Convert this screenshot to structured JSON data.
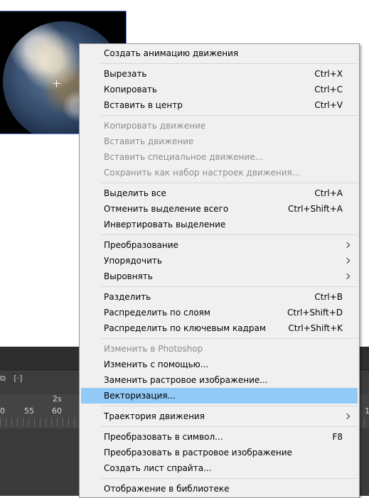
{
  "timeline": {
    "time_marker": "2s",
    "ruler_labels": [
      "0",
      "55",
      "60",
      "1"
    ]
  },
  "menu": {
    "items": [
      {
        "label": "Создать анимацию движения",
        "shortcut": "",
        "disabled": false,
        "submenu": false
      },
      {
        "label": "Вырезать",
        "shortcut": "Ctrl+X",
        "disabled": false,
        "submenu": false
      },
      {
        "label": "Копировать",
        "shortcut": "Ctrl+C",
        "disabled": false,
        "submenu": false
      },
      {
        "label": "Вставить в центр",
        "shortcut": "Ctrl+V",
        "disabled": false,
        "submenu": false
      },
      {
        "label": "Копировать движение",
        "shortcut": "",
        "disabled": true,
        "submenu": false
      },
      {
        "label": "Вставить движение",
        "shortcut": "",
        "disabled": true,
        "submenu": false
      },
      {
        "label": "Вставить специальное движение...",
        "shortcut": "",
        "disabled": true,
        "submenu": false
      },
      {
        "label": "Сохранить как набор настроек движения...",
        "shortcut": "",
        "disabled": true,
        "submenu": false
      },
      {
        "label": "Выделить все",
        "shortcut": "Ctrl+A",
        "disabled": false,
        "submenu": false
      },
      {
        "label": "Отменить выделение всего",
        "shortcut": "Ctrl+Shift+A",
        "disabled": false,
        "submenu": false
      },
      {
        "label": "Инвертировать выделение",
        "shortcut": "",
        "disabled": false,
        "submenu": false
      },
      {
        "label": "Преобразование",
        "shortcut": "",
        "disabled": false,
        "submenu": true
      },
      {
        "label": "Упорядочить",
        "shortcut": "",
        "disabled": false,
        "submenu": true
      },
      {
        "label": "Выровнять",
        "shortcut": "",
        "disabled": false,
        "submenu": true
      },
      {
        "label": "Разделить",
        "shortcut": "Ctrl+B",
        "disabled": false,
        "submenu": false
      },
      {
        "label": "Распределить по слоям",
        "shortcut": "Ctrl+Shift+D",
        "disabled": false,
        "submenu": false
      },
      {
        "label": "Распределить по ключевым кадрам",
        "shortcut": "Ctrl+Shift+K",
        "disabled": false,
        "submenu": false
      },
      {
        "label": "Изменить в Photoshop",
        "shortcut": "",
        "disabled": true,
        "submenu": false
      },
      {
        "label": "Изменить с помощью...",
        "shortcut": "",
        "disabled": false,
        "submenu": false
      },
      {
        "label": "Заменить растровое изображение...",
        "shortcut": "",
        "disabled": false,
        "submenu": false
      },
      {
        "label": "Векторизация...",
        "shortcut": "",
        "disabled": false,
        "submenu": false,
        "highlighted": true
      },
      {
        "label": "Траектория движения",
        "shortcut": "",
        "disabled": false,
        "submenu": true
      },
      {
        "label": "Преобразовать в символ...",
        "shortcut": "F8",
        "disabled": false,
        "submenu": false
      },
      {
        "label": "Преобразовать в растровое изображение",
        "shortcut": "",
        "disabled": false,
        "submenu": false
      },
      {
        "label": "Создать лист спрайта...",
        "shortcut": "",
        "disabled": false,
        "submenu": false
      },
      {
        "label": "Отображение в библиотеке",
        "shortcut": "",
        "disabled": false,
        "submenu": false
      }
    ]
  }
}
